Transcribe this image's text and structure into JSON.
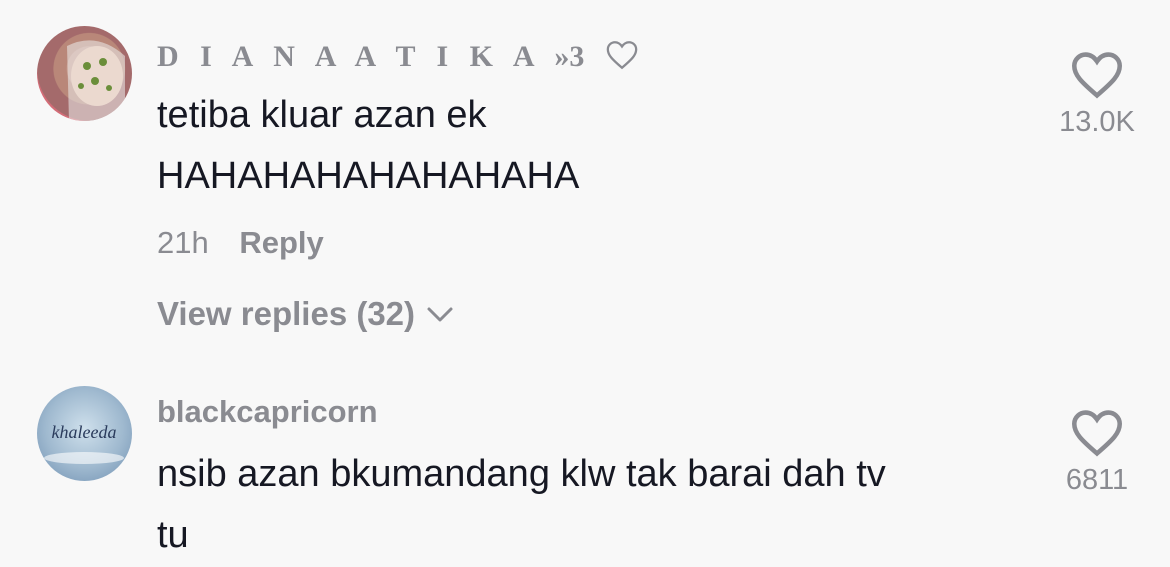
{
  "comments": [
    {
      "username_letters": "D I A N A A T I K A",
      "username_suffix": "»3",
      "text_lines": [
        "tetiba kluar azan ek",
        "HAHAHAHAHAHAHAHA"
      ],
      "time": "21h",
      "reply_label": "Reply",
      "view_replies": "View replies (32)",
      "likes": "13.0K",
      "avatar_icon": "user-avatar-icon"
    },
    {
      "username": "blackcapricorn",
      "text_lines": [
        "nsib azan bkumandang klw tak barai dah tv",
        "tu"
      ],
      "likes": "6811",
      "avatar_text": "khaleeda",
      "avatar_icon": "user-avatar-icon"
    }
  ],
  "colors": {
    "background": "#f8f8f8",
    "text_primary": "#161823",
    "text_secondary": "#8a8b91"
  }
}
